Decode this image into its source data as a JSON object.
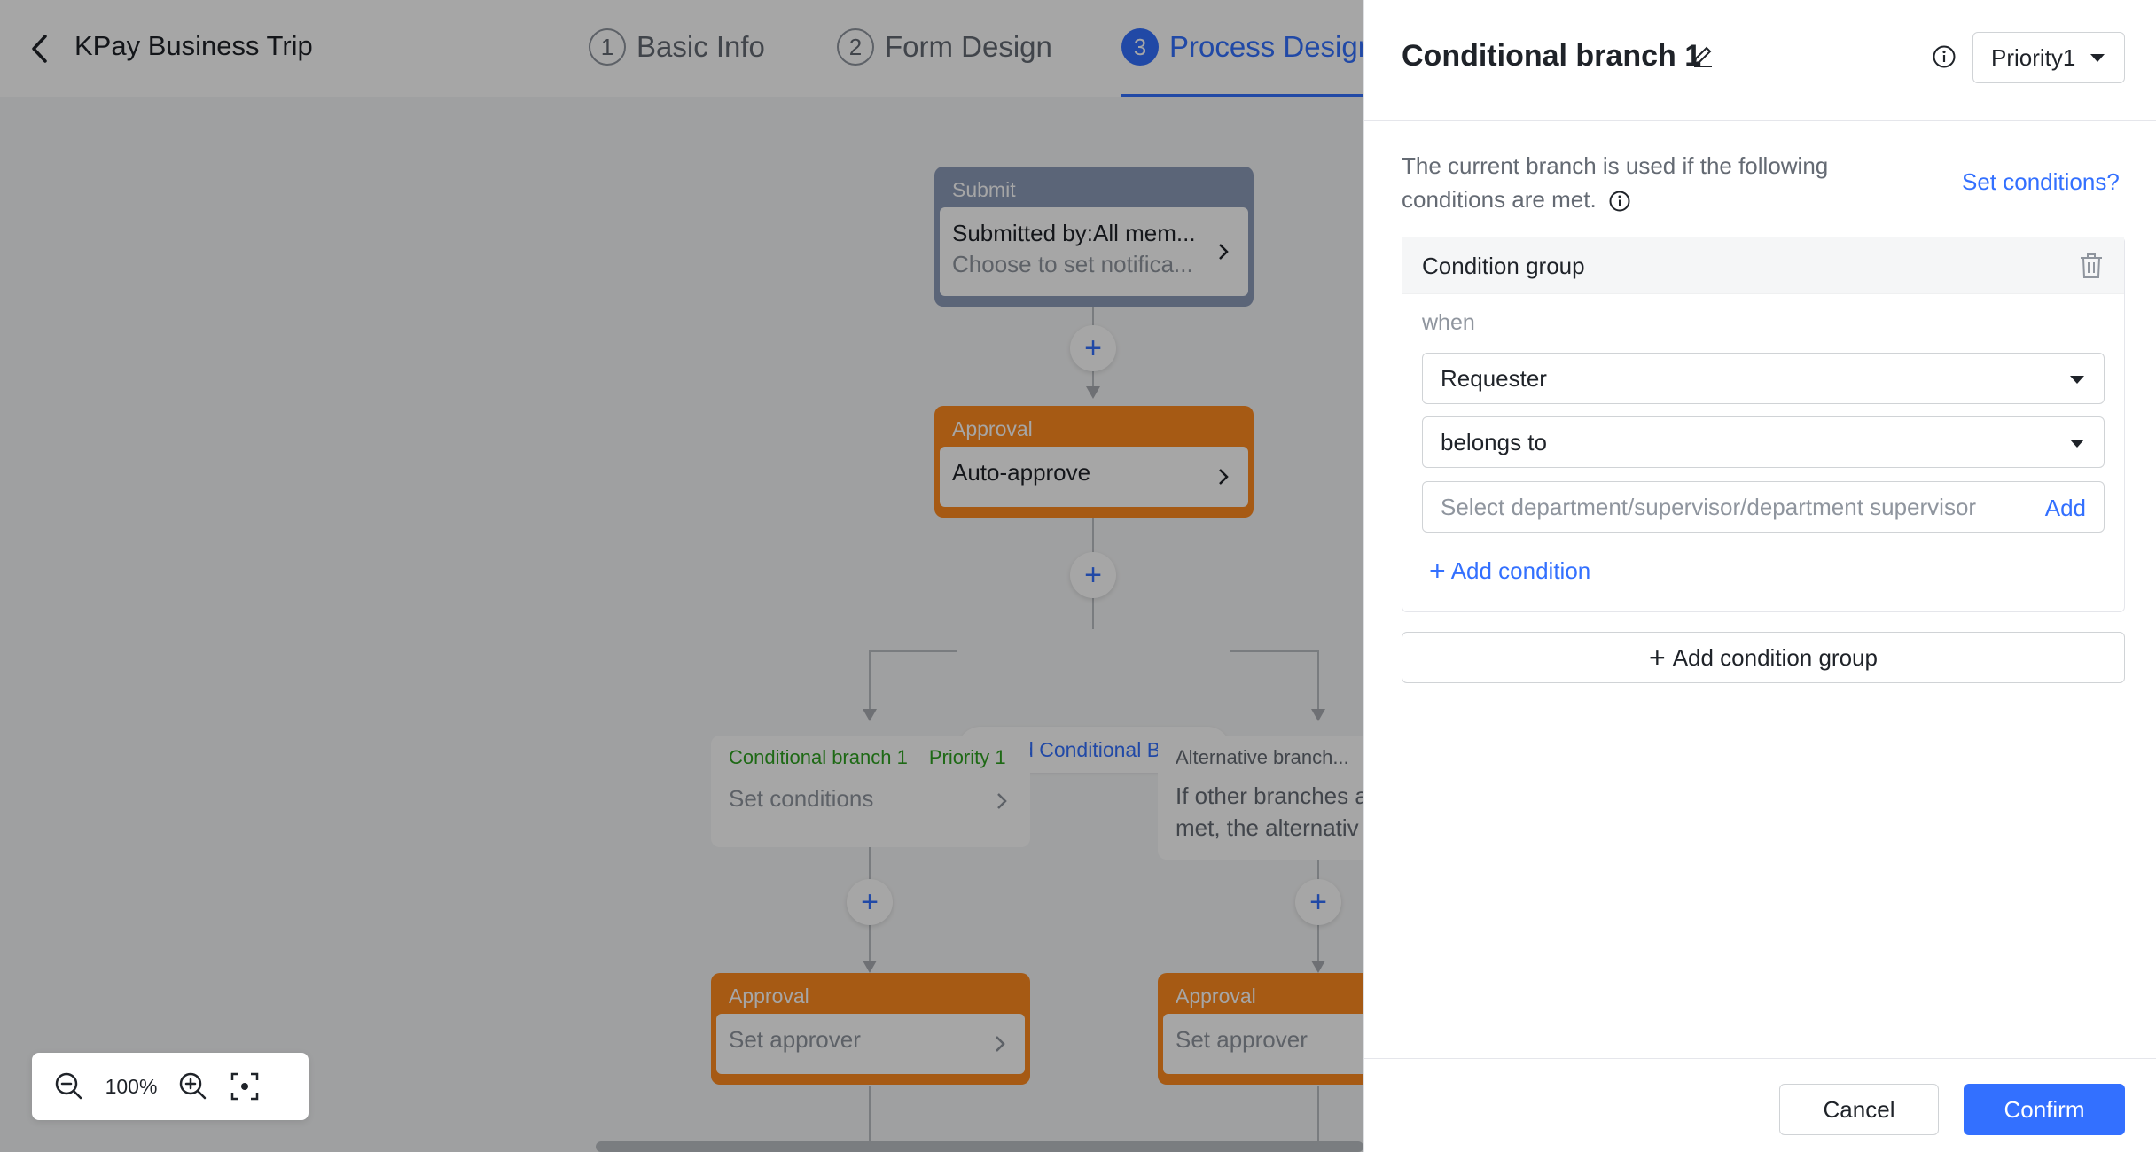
{
  "header": {
    "title": "KPay Business Trip",
    "steps": [
      {
        "num": "1",
        "label": "Basic Info"
      },
      {
        "num": "2",
        "label": "Form Design"
      },
      {
        "num": "3",
        "label": "Process Design"
      }
    ]
  },
  "flow": {
    "submit_node": {
      "head": "Submit",
      "line1": "Submitted by:All mem...",
      "line2": "Choose to set notifica..."
    },
    "approval_node": {
      "head": "Approval",
      "line1": "Auto-approve"
    },
    "add_branch_label": "Add Conditional Branch",
    "branch1": {
      "name": "Conditional branch 1",
      "priority": "Priority 1",
      "body": "Set conditions"
    },
    "branch_alt": {
      "name": "Alternative branch...",
      "body1": "If other branches a",
      "body2": "met, the alternativ"
    },
    "approval_left": {
      "head": "Approval",
      "line1": "Set approver"
    },
    "approval_right": {
      "head": "Approval",
      "line1": "Set approver"
    }
  },
  "zoom": {
    "level": "100%"
  },
  "panel": {
    "title": "Conditional branch 1",
    "priority": "Priority1",
    "description": "The current branch is used if the following conditions are met.",
    "set_conditions_link": "Set conditions?",
    "group": {
      "title": "Condition group",
      "when": "when",
      "field": "Requester",
      "operator": "belongs to",
      "value_placeholder": "Select department/supervisor/department supervisor",
      "add_label": "Add",
      "add_condition": "Add condition"
    },
    "add_group": "Add condition group",
    "cancel": "Cancel",
    "confirm": "Confirm"
  },
  "colors": {
    "accent": "#3370ff",
    "approval": "#ff8a1f",
    "submit": "#8d9bb8",
    "branch_text": "#2ea121"
  }
}
